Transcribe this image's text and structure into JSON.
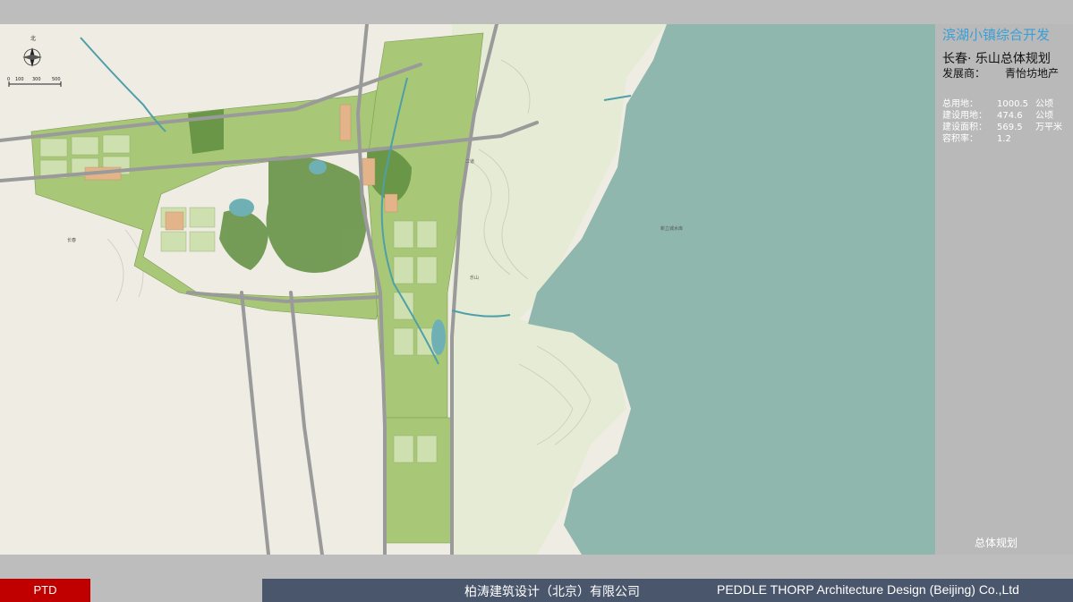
{
  "panel": {
    "brand_title": "滨湖小镇综合开发",
    "plan_title": "长春· 乐山总体规划",
    "developer_label": "发展商：",
    "developer_value": "青怡坊地产",
    "stats": [
      {
        "label": "总用地：",
        "value": "1000.5",
        "unit": "公顷"
      },
      {
        "label": "建设用地：",
        "value": "474.6",
        "unit": "公顷"
      },
      {
        "label": "建设面积：",
        "value": "569.5",
        "unit": "万平米"
      },
      {
        "label": "容积率：",
        "value": "1.2",
        "unit": ""
      }
    ],
    "caption": "总体规划"
  },
  "map": {
    "north_label": "北",
    "scale_ticks": [
      "0",
      "100",
      "300",
      "500"
    ],
    "place_labels": [
      "长春",
      "乐山",
      "新立城水库",
      "二道"
    ],
    "colors": {
      "lake": "#8fb7ad",
      "paper": "#efece4",
      "park": "#5f8f3f",
      "residential": "#a8c878",
      "road": "#9a9a9a",
      "river": "#4f9fa8"
    }
  },
  "footer": {
    "ptd_label": "PTD",
    "company_cn": "柏涛建筑设计（北京）有限公司",
    "company_en": "PEDDLE THORP Architecture Design (Beijing) Co.,Ltd"
  }
}
